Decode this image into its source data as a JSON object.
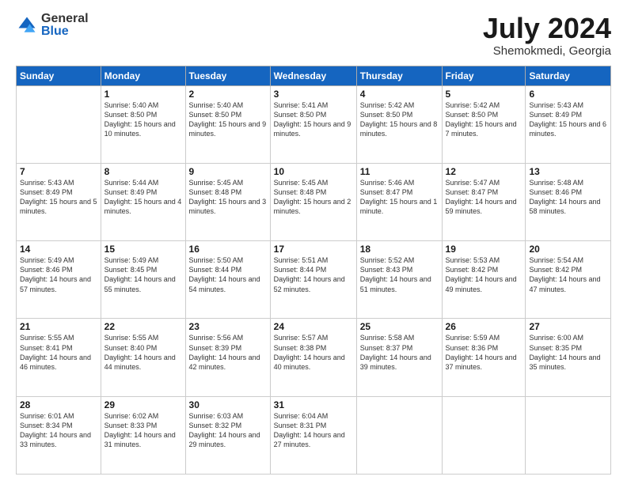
{
  "header": {
    "logo_general": "General",
    "logo_blue": "Blue",
    "title": "July 2024",
    "location": "Shemokmedi, Georgia"
  },
  "days_of_week": [
    "Sunday",
    "Monday",
    "Tuesday",
    "Wednesday",
    "Thursday",
    "Friday",
    "Saturday"
  ],
  "weeks": [
    [
      {
        "day": "",
        "info": ""
      },
      {
        "day": "1",
        "info": "Sunrise: 5:40 AM\nSunset: 8:50 PM\nDaylight: 15 hours\nand 10 minutes."
      },
      {
        "day": "2",
        "info": "Sunrise: 5:40 AM\nSunset: 8:50 PM\nDaylight: 15 hours\nand 9 minutes."
      },
      {
        "day": "3",
        "info": "Sunrise: 5:41 AM\nSunset: 8:50 PM\nDaylight: 15 hours\nand 9 minutes."
      },
      {
        "day": "4",
        "info": "Sunrise: 5:42 AM\nSunset: 8:50 PM\nDaylight: 15 hours\nand 8 minutes."
      },
      {
        "day": "5",
        "info": "Sunrise: 5:42 AM\nSunset: 8:50 PM\nDaylight: 15 hours\nand 7 minutes."
      },
      {
        "day": "6",
        "info": "Sunrise: 5:43 AM\nSunset: 8:49 PM\nDaylight: 15 hours\nand 6 minutes."
      }
    ],
    [
      {
        "day": "7",
        "info": "Sunrise: 5:43 AM\nSunset: 8:49 PM\nDaylight: 15 hours\nand 5 minutes."
      },
      {
        "day": "8",
        "info": "Sunrise: 5:44 AM\nSunset: 8:49 PM\nDaylight: 15 hours\nand 4 minutes."
      },
      {
        "day": "9",
        "info": "Sunrise: 5:45 AM\nSunset: 8:48 PM\nDaylight: 15 hours\nand 3 minutes."
      },
      {
        "day": "10",
        "info": "Sunrise: 5:45 AM\nSunset: 8:48 PM\nDaylight: 15 hours\nand 2 minutes."
      },
      {
        "day": "11",
        "info": "Sunrise: 5:46 AM\nSunset: 8:47 PM\nDaylight: 15 hours\nand 1 minute."
      },
      {
        "day": "12",
        "info": "Sunrise: 5:47 AM\nSunset: 8:47 PM\nDaylight: 14 hours\nand 59 minutes."
      },
      {
        "day": "13",
        "info": "Sunrise: 5:48 AM\nSunset: 8:46 PM\nDaylight: 14 hours\nand 58 minutes."
      }
    ],
    [
      {
        "day": "14",
        "info": "Sunrise: 5:49 AM\nSunset: 8:46 PM\nDaylight: 14 hours\nand 57 minutes."
      },
      {
        "day": "15",
        "info": "Sunrise: 5:49 AM\nSunset: 8:45 PM\nDaylight: 14 hours\nand 55 minutes."
      },
      {
        "day": "16",
        "info": "Sunrise: 5:50 AM\nSunset: 8:44 PM\nDaylight: 14 hours\nand 54 minutes."
      },
      {
        "day": "17",
        "info": "Sunrise: 5:51 AM\nSunset: 8:44 PM\nDaylight: 14 hours\nand 52 minutes."
      },
      {
        "day": "18",
        "info": "Sunrise: 5:52 AM\nSunset: 8:43 PM\nDaylight: 14 hours\nand 51 minutes."
      },
      {
        "day": "19",
        "info": "Sunrise: 5:53 AM\nSunset: 8:42 PM\nDaylight: 14 hours\nand 49 minutes."
      },
      {
        "day": "20",
        "info": "Sunrise: 5:54 AM\nSunset: 8:42 PM\nDaylight: 14 hours\nand 47 minutes."
      }
    ],
    [
      {
        "day": "21",
        "info": "Sunrise: 5:55 AM\nSunset: 8:41 PM\nDaylight: 14 hours\nand 46 minutes."
      },
      {
        "day": "22",
        "info": "Sunrise: 5:55 AM\nSunset: 8:40 PM\nDaylight: 14 hours\nand 44 minutes."
      },
      {
        "day": "23",
        "info": "Sunrise: 5:56 AM\nSunset: 8:39 PM\nDaylight: 14 hours\nand 42 minutes."
      },
      {
        "day": "24",
        "info": "Sunrise: 5:57 AM\nSunset: 8:38 PM\nDaylight: 14 hours\nand 40 minutes."
      },
      {
        "day": "25",
        "info": "Sunrise: 5:58 AM\nSunset: 8:37 PM\nDaylight: 14 hours\nand 39 minutes."
      },
      {
        "day": "26",
        "info": "Sunrise: 5:59 AM\nSunset: 8:36 PM\nDaylight: 14 hours\nand 37 minutes."
      },
      {
        "day": "27",
        "info": "Sunrise: 6:00 AM\nSunset: 8:35 PM\nDaylight: 14 hours\nand 35 minutes."
      }
    ],
    [
      {
        "day": "28",
        "info": "Sunrise: 6:01 AM\nSunset: 8:34 PM\nDaylight: 14 hours\nand 33 minutes."
      },
      {
        "day": "29",
        "info": "Sunrise: 6:02 AM\nSunset: 8:33 PM\nDaylight: 14 hours\nand 31 minutes."
      },
      {
        "day": "30",
        "info": "Sunrise: 6:03 AM\nSunset: 8:32 PM\nDaylight: 14 hours\nand 29 minutes."
      },
      {
        "day": "31",
        "info": "Sunrise: 6:04 AM\nSunset: 8:31 PM\nDaylight: 14 hours\nand 27 minutes."
      },
      {
        "day": "",
        "info": ""
      },
      {
        "day": "",
        "info": ""
      },
      {
        "day": "",
        "info": ""
      }
    ]
  ]
}
